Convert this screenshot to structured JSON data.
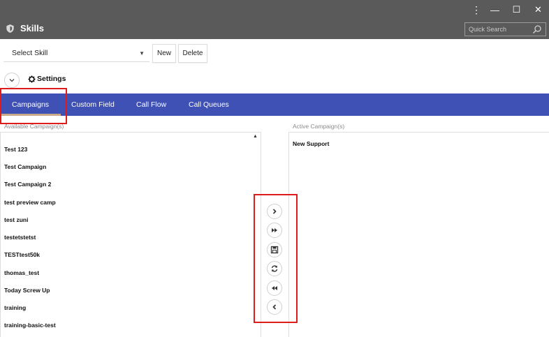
{
  "window": {
    "title": "Skills",
    "controls": [
      "⋮",
      "—",
      "☐",
      "✕"
    ]
  },
  "search": {
    "placeholder": "Quick Search"
  },
  "skill_select": {
    "value": "Select Skill"
  },
  "buttons": {
    "new": "New",
    "delete": "Delete"
  },
  "settings": {
    "label": "Settings"
  },
  "tabs": [
    {
      "label": "Campaigns",
      "active": true
    },
    {
      "label": "Custom Field"
    },
    {
      "label": "Call Flow"
    },
    {
      "label": "Call Queues"
    }
  ],
  "available": {
    "label": "Available Campaign(s)",
    "items": [
      "Test 123",
      "Test Campaign",
      "Test Campaign 2",
      "test preview camp",
      "test zuni",
      "testetstetst",
      "TESTtest50k",
      "thomas_test",
      "Today Screw Up",
      "training",
      "training-basic-test"
    ]
  },
  "active": {
    "label": "Active Campaign(s)",
    "items": [
      "New Support"
    ]
  },
  "colors": {
    "titlebar": "#5a5a5a",
    "tabbar": "#3f51b5",
    "highlight": "#e01b1b"
  },
  "icons": {
    "transfer": [
      "chevron-right-icon",
      "double-right-icon",
      "save-icon",
      "refresh-icon",
      "double-left-icon",
      "chevron-left-icon"
    ]
  }
}
